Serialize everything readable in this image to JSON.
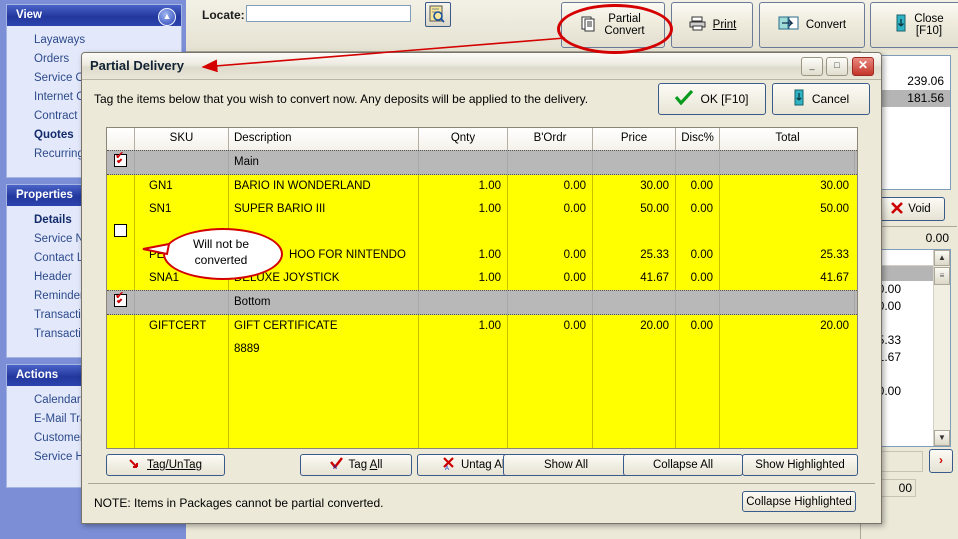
{
  "sidebar": {
    "sections": [
      {
        "title": "View",
        "collapse_icon": "chevrons-up-icon",
        "items": [
          {
            "label": "Layaways",
            "selected": false
          },
          {
            "label": "Orders",
            "selected": false
          },
          {
            "label": "Service O",
            "selected": false
          },
          {
            "label": "Internet O",
            "selected": false
          },
          {
            "label": "Contract I",
            "selected": false
          },
          {
            "label": "Quotes",
            "selected": true
          },
          {
            "label": "Recurring",
            "selected": false
          }
        ]
      },
      {
        "title": "Properties",
        "collapse_icon": "",
        "items": [
          {
            "label": "Details",
            "selected": true
          },
          {
            "label": "Service N",
            "selected": false
          },
          {
            "label": "Contact L",
            "selected": false
          },
          {
            "label": "Header",
            "selected": false
          },
          {
            "label": "Reminder",
            "selected": false
          },
          {
            "label": "Transacti",
            "selected": false
          },
          {
            "label": "Transacti",
            "selected": false
          }
        ]
      },
      {
        "title": "Actions",
        "collapse_icon": "",
        "items": [
          {
            "label": "Calendar",
            "selected": false
          },
          {
            "label": "E-Mail Tra",
            "selected": false
          },
          {
            "label": "Customer",
            "selected": false
          },
          {
            "label": "Service H",
            "selected": false
          }
        ]
      }
    ]
  },
  "toolbar": {
    "locate_label": "Locate:",
    "locate_value": "",
    "locate_placeholder": "",
    "lookup_icon": "document-search-icon",
    "buttons": [
      {
        "name": "partial-convert",
        "line1": "Partial",
        "line2": "Convert",
        "icon": "documents-icon",
        "underline": ""
      },
      {
        "name": "print",
        "line1": "Print",
        "line2": "",
        "icon": "printer-icon",
        "underline": "P"
      },
      {
        "name": "convert",
        "line1": "Convert",
        "line2": "",
        "icon": "convert-icon",
        "underline": "v"
      },
      {
        "name": "close",
        "line1": "Close",
        "line2": "[F10]",
        "icon": "exit-door-icon",
        "underline": ""
      }
    ]
  },
  "right_panel": {
    "totals": [
      "239.06",
      "181.56"
    ],
    "void_label": "Void",
    "void_icon": "red-x-icon",
    "zero_value": "0.00",
    "line_amounts": [
      "",
      "",
      "30.00",
      "50.00",
      "",
      "25.33",
      "41.67",
      "",
      "20.00"
    ],
    "nav_label": "›",
    "bottom_amount": "00",
    "scroll_up_icon": "chevron-up-icon",
    "scroll_down_icon": "chevron-down-icon"
  },
  "dialog": {
    "title": "Partial Delivery",
    "minimize_icon": "minimize-icon",
    "maximize_icon": "maximize-icon",
    "close_icon": "close-icon",
    "instruction": "Tag the items below that you wish to convert now.  Any deposits will be applied to the delivery.",
    "ok_label": "OK [F10]",
    "ok_icon": "green-check-icon",
    "cancel_label": "Cancel",
    "cancel_icon": "exit-door-icon",
    "note": "NOTE: Items in Packages cannot be partial converted.",
    "columns": [
      "",
      "SKU",
      "Description",
      "Qnty",
      "B'Ordr",
      "Price",
      "Disc%",
      "Total"
    ],
    "rows": [
      {
        "type": "group",
        "checked": true,
        "sku": "",
        "desc": "Main",
        "qnty": "",
        "bordr": "",
        "price": "",
        "disc": "",
        "total": ""
      },
      {
        "type": "item",
        "checked": null,
        "sku": "GN1",
        "desc": "BARIO IN WONDERLAND",
        "qnty": "1.00",
        "bordr": "0.00",
        "price": "30.00",
        "disc": "0.00",
        "total": "30.00"
      },
      {
        "type": "item",
        "checked": null,
        "sku": "SN1",
        "desc": "SUPER BARIO III",
        "qnty": "1.00",
        "bordr": "0.00",
        "price": "50.00",
        "disc": "0.00",
        "total": "50.00"
      },
      {
        "type": "group",
        "checked": false,
        "sku": "",
        "desc": "",
        "qnty": "",
        "bordr": "",
        "price": "",
        "disc": "",
        "total": ""
      },
      {
        "type": "item",
        "checked": null,
        "sku": "PEEKA",
        "desc": "HOO FOR NINTENDO",
        "qnty": "1.00",
        "bordr": "0.00",
        "price": "25.33",
        "disc": "0.00",
        "total": "25.33"
      },
      {
        "type": "item",
        "checked": null,
        "sku": "SNA1",
        "desc": "DELUXE JOYSTICK",
        "qnty": "1.00",
        "bordr": "0.00",
        "price": "41.67",
        "disc": "0.00",
        "total": "41.67"
      },
      {
        "type": "group",
        "checked": true,
        "sku": "",
        "desc": "Bottom",
        "qnty": "",
        "bordr": "",
        "price": "",
        "disc": "",
        "total": ""
      },
      {
        "type": "item",
        "checked": null,
        "sku": "GIFTCERT",
        "desc": "GIFT CERTIFICATE",
        "qnty": "1.00",
        "bordr": "0.00",
        "price": "20.00",
        "disc": "0.00",
        "total": "20.00"
      },
      {
        "type": "item",
        "checked": null,
        "sku": "",
        "desc": "8889",
        "qnty": "",
        "bordr": "",
        "price": "",
        "disc": "",
        "total": ""
      }
    ],
    "footer_buttons": [
      {
        "name": "tag-untag",
        "label": "Tag/UnTag",
        "icon": "red-arrow-icon"
      },
      {
        "name": "tag-all",
        "label": "Tag All",
        "icon": "red-check-a-icon"
      },
      {
        "name": "untag-all",
        "label": "Untag All",
        "icon": "red-x-a-icon"
      },
      {
        "name": "show-all",
        "label": "Show All",
        "icon": ""
      },
      {
        "name": "collapse-all",
        "label": "Collapse All",
        "icon": ""
      },
      {
        "name": "show-highlighted",
        "label": "Show Highlighted",
        "icon": ""
      }
    ],
    "collapse_highlighted_label": "Collapse Highlighted"
  },
  "annotations": {
    "callout_line1": "Will not be",
    "callout_line2": "converted",
    "highlight_color": "#d40000"
  }
}
